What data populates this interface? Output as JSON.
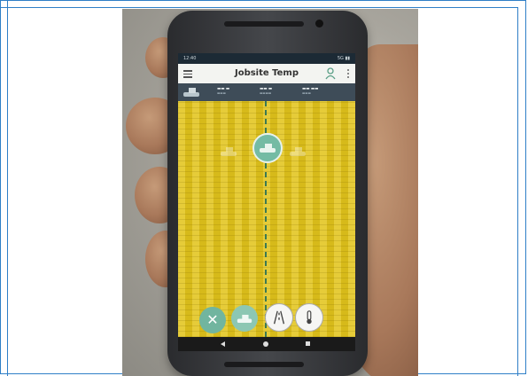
{
  "app": {
    "title": "Jobsite Temp",
    "status_time": "12:40",
    "status_signal": "5G ▮▮"
  },
  "icons": {
    "menu": "hamburger-menu-icon",
    "person": "person-icon",
    "more": "kebab-menu-icon",
    "roller": "roller-compactor-icon",
    "close": "close-icon",
    "lanes": "lanes-icon",
    "temperature": "thermometer-icon"
  },
  "colors": {
    "field": "#e2c51e",
    "accent": "#74bba4",
    "centerline": "#3b7a52",
    "appbar": "#f3f4f1",
    "infobar": "#3e4c58"
  },
  "fab_close_label": "✕"
}
